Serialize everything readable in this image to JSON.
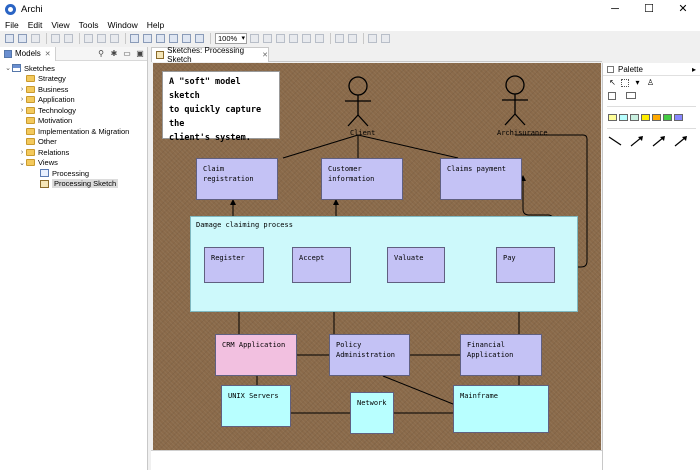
{
  "window": {
    "title": "Archi",
    "min": "─",
    "max": "☐",
    "close": "✕"
  },
  "menu": [
    "File",
    "Edit",
    "View",
    "Tools",
    "Window",
    "Help"
  ],
  "toolbar": {
    "zoom": "100%"
  },
  "models_panel": {
    "tab_label": "Models",
    "tab_close": "✕",
    "search_icon": "⚲",
    "filter_icon": "✱",
    "minimize_icon": "▭",
    "maximize_icon": "▣",
    "tree": {
      "root": "Sketches",
      "folders": [
        "Strategy",
        "Business",
        "Application",
        "Technology",
        "Motivation",
        "Implementation & Migration",
        "Other",
        "Relations",
        "Views"
      ],
      "views": [
        "Processing",
        "Processing Sketch"
      ]
    }
  },
  "editor": {
    "tab_label": "Sketches: Processing Sketch",
    "tab_close": "✕"
  },
  "palette": {
    "title": "Palette",
    "collapse": "▸",
    "swatch_colors": [
      "#ffff99",
      "#b8ffff",
      "#c8f0e0",
      "#ffee00",
      "#ffaa00",
      "#44cc44",
      "#8888ff"
    ]
  },
  "diagram": {
    "note": [
      "A \"soft\" model sketch",
      "to quickly capture the",
      "client's system."
    ],
    "actors": {
      "client": "Client",
      "archisurance": "Archisurance"
    },
    "services": {
      "claim_registration": "Claim registration",
      "customer_information": [
        "Customer",
        "information"
      ],
      "claims_payment": "Claims payment"
    },
    "group": "Damage claiming process",
    "steps": {
      "register": "Register",
      "accept": "Accept",
      "valuate": "Valuate",
      "pay": "Pay"
    },
    "apps": {
      "crm": "CRM Application",
      "policy": [
        "Policy",
        "Administration"
      ],
      "financial": "Financial Application"
    },
    "infra": {
      "unix": "UNIX Servers",
      "network": "Network",
      "mainframe": "Mainframe"
    }
  }
}
